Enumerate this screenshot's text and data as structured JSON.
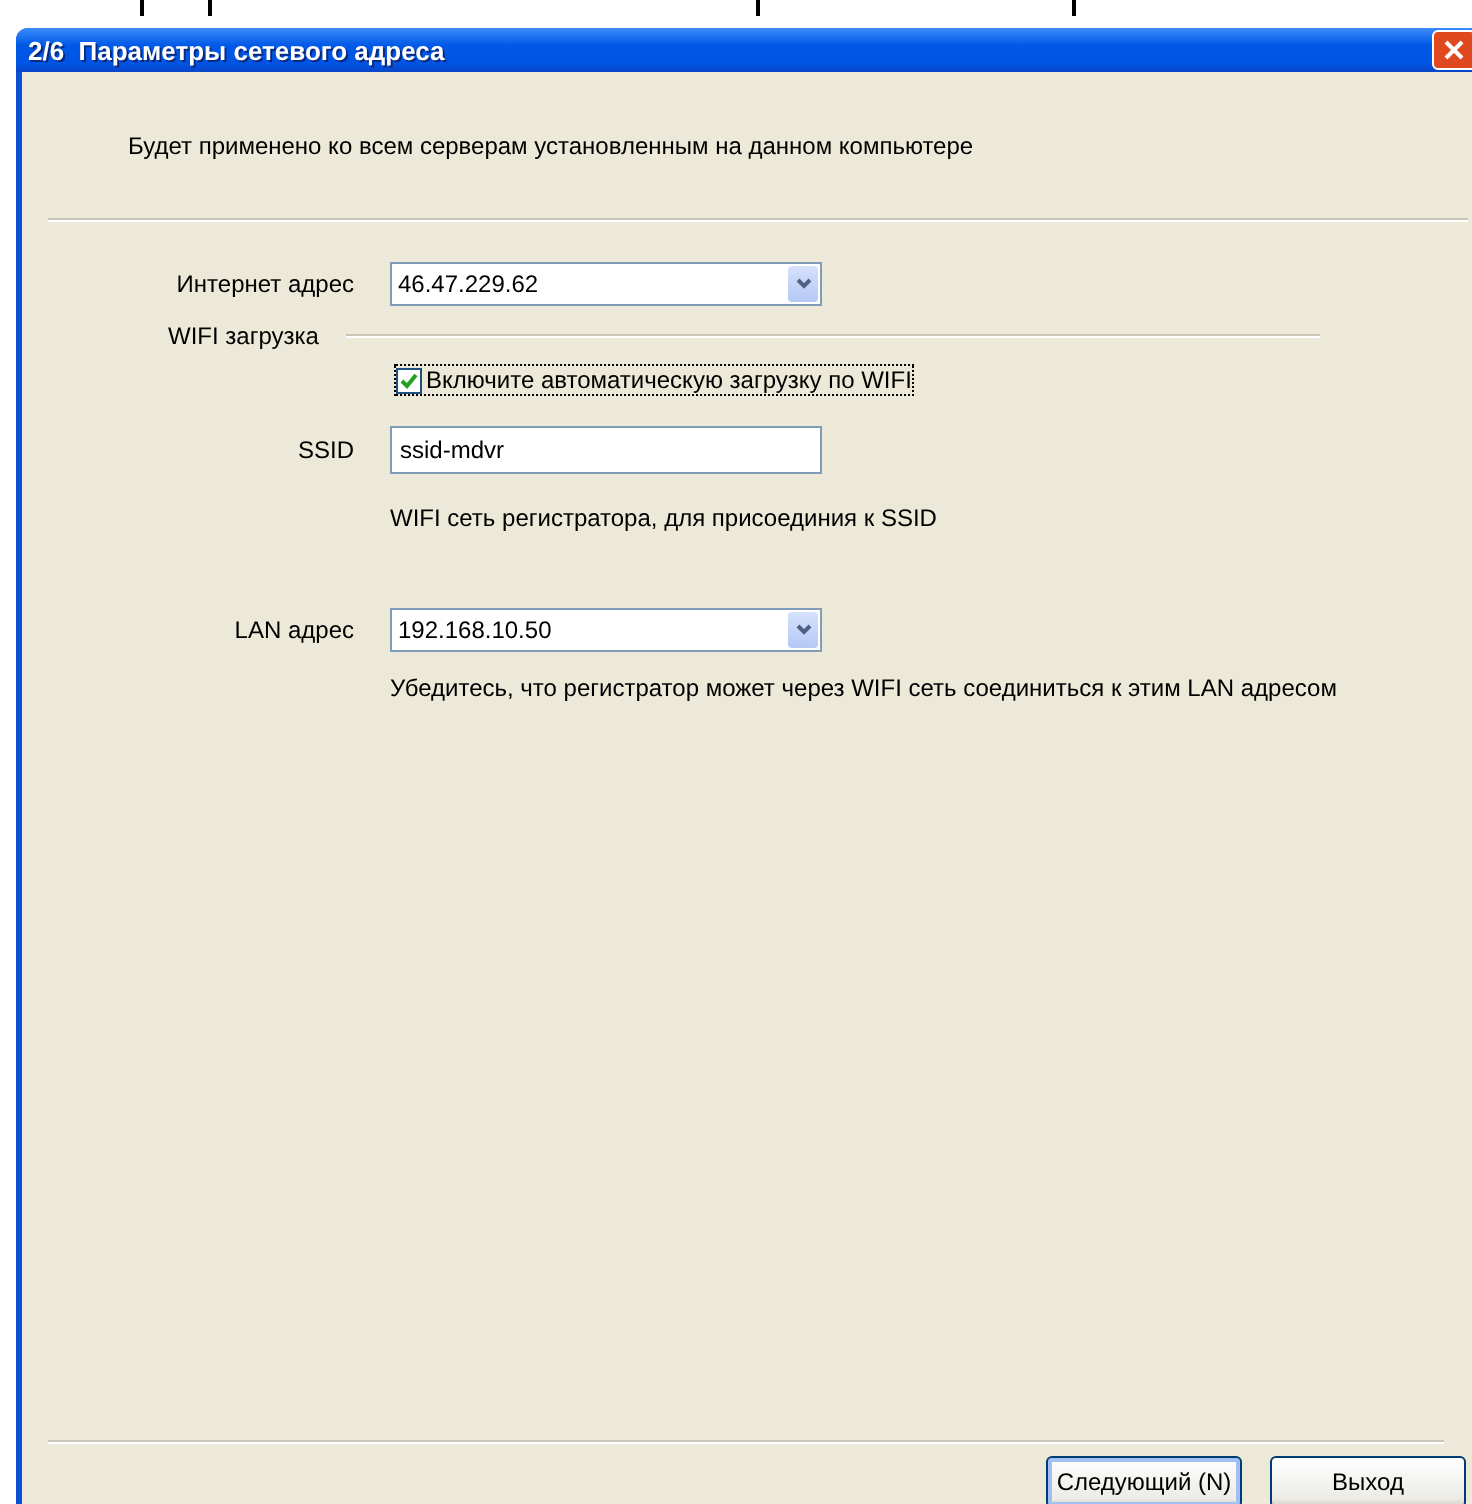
{
  "window": {
    "title": "2/6  Параметры сетевого адреса"
  },
  "intro": "Будет применено ко всем серверам установленным на данном компьютере",
  "internet_address": {
    "label": "Интернет адрес",
    "value": "46.47.229.62"
  },
  "wifi_section": {
    "title": "WIFI загрузка",
    "auto_upload": {
      "label": "Включите автоматическую загрузку по WIFI",
      "checked": true
    },
    "ssid": {
      "label": "SSID",
      "value": "ssid-mdvr",
      "hint": "WIFI сеть регистратора, для присоединия к SSID"
    },
    "lan_address": {
      "label": "LAN адрес",
      "value": "192.168.10.50",
      "hint": "Убедитесь, что регистратор может через WIFI сеть соединиться к этим LAN адресом"
    }
  },
  "buttons": [
    {
      "label": "Следующий (N)",
      "focused": true
    },
    {
      "label": "Выход",
      "focused": false
    }
  ]
}
